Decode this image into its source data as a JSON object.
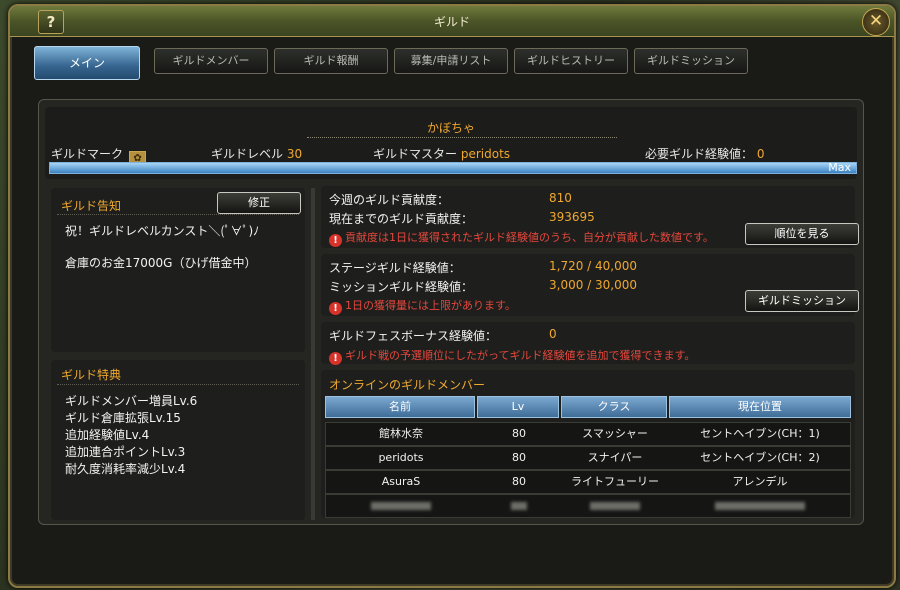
{
  "window": {
    "title": "ギルド",
    "help_label": "?",
    "close_label": "✕"
  },
  "tabs": [
    {
      "label": "メイン",
      "active": true
    },
    {
      "label": "ギルドメンバー"
    },
    {
      "label": "ギルド報酬"
    },
    {
      "label": "募集/申請リスト"
    },
    {
      "label": "ギルドヒストリー"
    },
    {
      "label": "ギルドミッション"
    }
  ],
  "header": {
    "guild_name": "かぼちゃ",
    "mark_label": "ギルドマーク",
    "level_label": "ギルドレベル",
    "level_value": "30",
    "master_label": "ギルドマスター",
    "master_value": "peridots",
    "required_exp_label": "必要ギルド経験値：",
    "required_exp_value": "0",
    "exp_progress": 1.0,
    "max_label": "Max"
  },
  "notice": {
    "title": "ギルド告知",
    "edit_label": "修正",
    "lines": [
      "祝！ギルドレベルカンスト＼(ﾟ∀ﾟ)ﾉ",
      "倉庫のお金17000G（ひげ借金中）"
    ]
  },
  "perks": {
    "title": "ギルド特典",
    "items": [
      "ギルドメンバー増員Lv.6",
      "ギルド倉庫拡張Lv.15",
      "追加経験値Lv.4",
      "追加連合ポイントLv.3",
      "耐久度消耗率減少Lv.4"
    ]
  },
  "contribution": {
    "weekly_label": "今週のギルド貢献度：",
    "weekly_value": "810",
    "total_label": "現在までのギルド貢献度：",
    "total_value": "393695",
    "note": "貢献度は1日に獲得されたギルド経験値のうち、自分が貢献した数値です。",
    "rank_button": "順位を見る"
  },
  "experience": {
    "stage_label": "ステージギルド経験値：",
    "stage_value": "1,720 / 40,000",
    "mission_label": "ミッションギルド経験値：",
    "mission_value": "3,000 / 30,000",
    "note": "1日の獲得量には上限があります。",
    "mission_button": "ギルドミッション"
  },
  "festival": {
    "label": "ギルドフェスボーナス経験値：",
    "value": "0",
    "note": "ギルド戦の予選順位にしたがってギルド経験値を追加で獲得できます。"
  },
  "online": {
    "title": "オンラインのギルドメンバー",
    "columns": [
      "名前",
      "Lv",
      "クラス",
      "現在位置"
    ],
    "rows": [
      [
        "館林水奈",
        "80",
        "スマッシャー",
        "セントヘイブン(CH：1)"
      ],
      [
        "peridots",
        "80",
        "スナイパー",
        "セントヘイブン(CH：2)"
      ],
      [
        "AsuraS",
        "80",
        "ライトフューリー",
        "アレンデル"
      ]
    ]
  },
  "colors": {
    "accent": "#f0a830",
    "warning": "#e4473d",
    "tab_active": "#36658f",
    "exp_bar": "#7db1d9"
  },
  "icons": [
    "help-icon",
    "close-icon",
    "guild-mark-icon",
    "warning-icon"
  ]
}
